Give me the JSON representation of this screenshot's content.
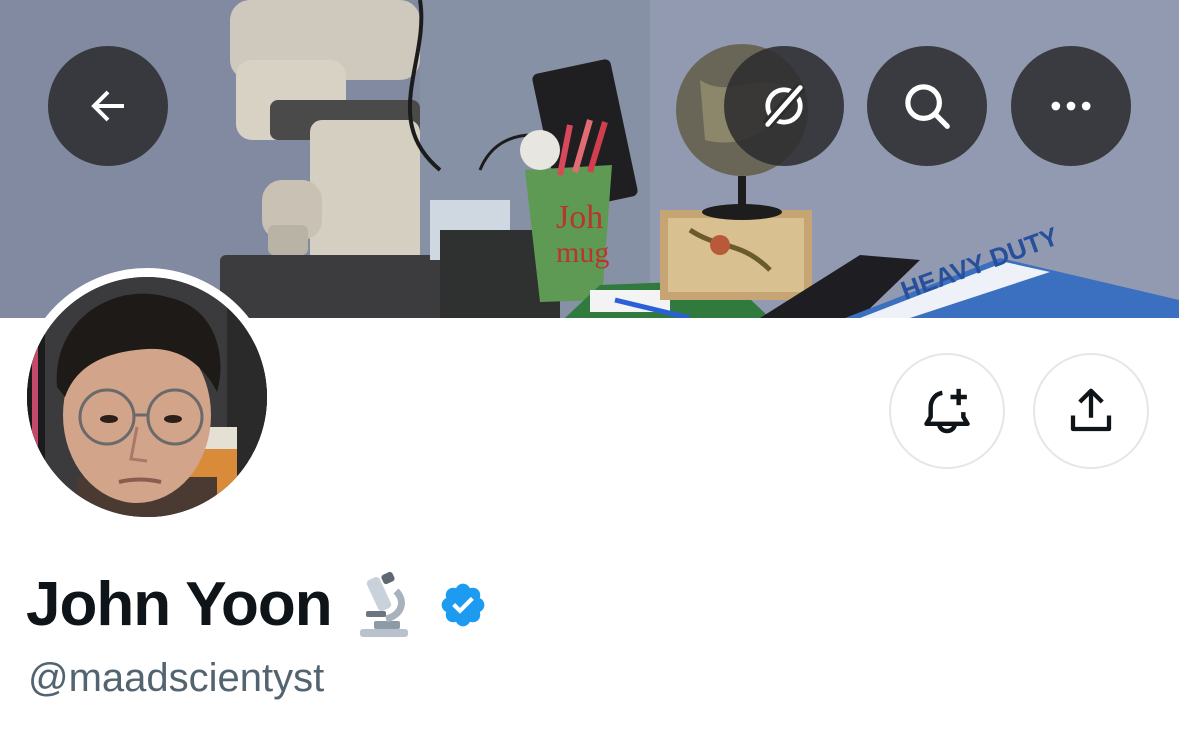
{
  "header": {
    "back_button": {
      "icon": "arrow-left-icon"
    },
    "grok_button": {
      "icon": "grok-icon"
    },
    "search_button": {
      "icon": "search-icon"
    },
    "more_button": {
      "icon": "more-horizontal-icon"
    }
  },
  "profile": {
    "display_name": "John Yoon",
    "name_emoji": "microscope-icon",
    "verified_badge": {
      "icon": "verified-badge-icon",
      "color": "#1d9bf0"
    },
    "handle": "@maadscientyst"
  },
  "actions": {
    "notify_button": {
      "icon": "bell-plus-icon"
    },
    "share_button": {
      "icon": "share-upload-icon"
    }
  },
  "colors": {
    "text_primary": "#0f1419",
    "text_secondary": "#536471",
    "overlay_button_bg": "#2d2d30",
    "verified": "#1d9bf0",
    "action_button_border": "#e3e6ea"
  }
}
